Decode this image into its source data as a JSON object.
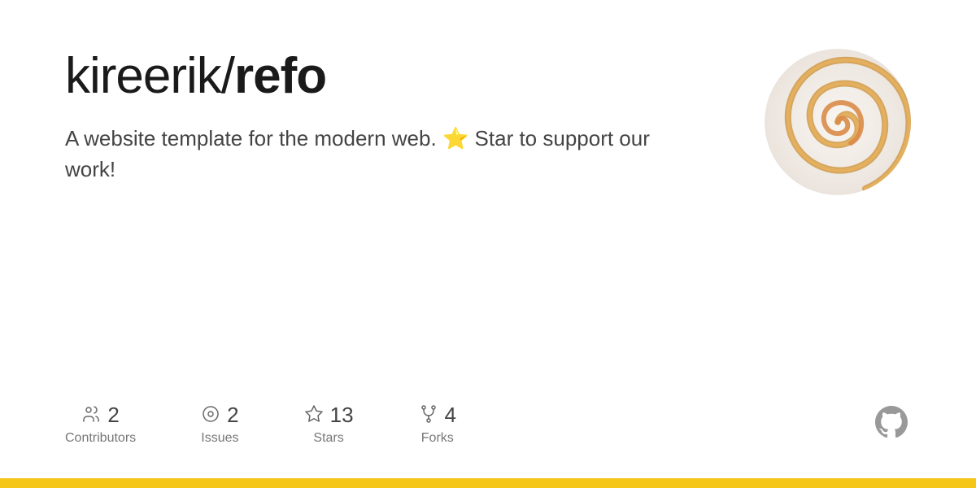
{
  "header": {
    "title_prefix": "kireerik/",
    "title_bold": "refo"
  },
  "description": {
    "text_before": "A website template for the modern web.",
    "star_emoji": "⭐",
    "text_after": "Star to support our work!"
  },
  "stats": [
    {
      "icon": "contributors",
      "count": "2",
      "label": "Contributors"
    },
    {
      "icon": "issues",
      "count": "2",
      "label": "Issues"
    },
    {
      "icon": "stars",
      "count": "13",
      "label": "Stars"
    },
    {
      "icon": "forks",
      "count": "4",
      "label": "Forks"
    }
  ],
  "bottom_bar": {
    "color": "#f5c518"
  }
}
